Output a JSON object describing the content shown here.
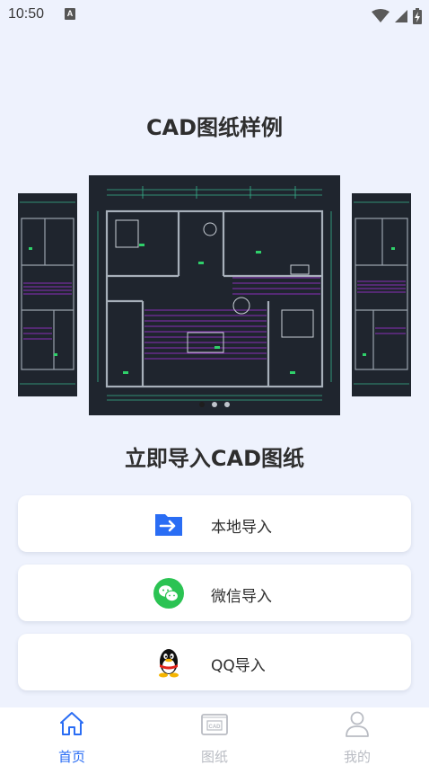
{
  "status_bar": {
    "time": "10:50",
    "notification_badge": "A",
    "icons": [
      "wifi-icon",
      "signal-icon",
      "battery-charging-icon"
    ]
  },
  "sample_section": {
    "title": "CAD图纸样例",
    "slides": [
      "cad-floorplan-thumb-1",
      "cad-floorplan-main",
      "cad-floorplan-thumb-2"
    ],
    "dot_count": 3,
    "active_dot": 0
  },
  "import_section": {
    "title": "立即导入CAD图纸",
    "options": [
      {
        "label": "本地导入",
        "icon": "folder-arrow-icon"
      },
      {
        "label": "微信导入",
        "icon": "wechat-icon"
      },
      {
        "label": "QQ导入",
        "icon": "qq-penguin-icon"
      }
    ]
  },
  "bottom_nav": {
    "items": [
      {
        "label": "首页",
        "icon": "home-icon",
        "active": true
      },
      {
        "label": "图纸",
        "icon": "cad-drawing-icon",
        "active": false
      },
      {
        "label": "我的",
        "icon": "profile-icon",
        "active": false
      }
    ]
  },
  "colors": {
    "background": "#eef2fd",
    "accent": "#2a6df4",
    "nav_inactive": "#b9bcc3",
    "drawing_bg": "#1f252e",
    "wechat_green": "#2bc353"
  }
}
